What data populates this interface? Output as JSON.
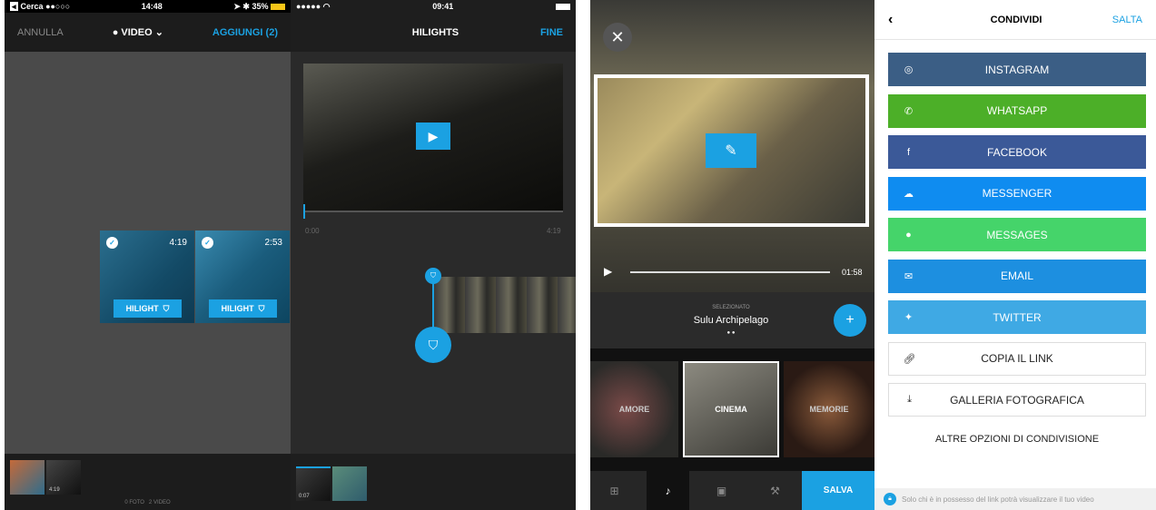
{
  "p1": {
    "status": {
      "left": "Cerca",
      "time": "14:48",
      "right": "35%"
    },
    "nav": {
      "left": "ANNULLA",
      "center": "VIDEO",
      "right": "AGGIUNGI (2)"
    },
    "tiles": [
      {
        "duration": "4:19",
        "label": "HILIGHT"
      },
      {
        "duration": "2:53",
        "label": "HILIGHT"
      }
    ],
    "thumb_duration": "4:19",
    "footer": "0 FOTO   2 VIDEO"
  },
  "p2": {
    "status": {
      "time": "09:41"
    },
    "nav": {
      "title": "HILIGHTS",
      "right": "FINE"
    },
    "time_start": "0:00",
    "time_end": "4:19",
    "thumb_time": "0:07"
  },
  "p3": {
    "duration": "01:58",
    "selected_label": "SELEZIONATO",
    "song": "Sulu Archipelago",
    "themes": [
      "AMORE",
      "CINEMA",
      "MEMORIE"
    ],
    "save": "SALVA"
  },
  "p4": {
    "nav": {
      "title": "CONDIVIDI",
      "right": "SALTA"
    },
    "buttons": [
      {
        "label": "INSTAGRAM",
        "icon": "instagram-icon",
        "color": "#3b5e85"
      },
      {
        "label": "WHATSAPP",
        "icon": "whatsapp-icon",
        "color": "#4caf28"
      },
      {
        "label": "FACEBOOK",
        "icon": "facebook-icon",
        "color": "#3b5998"
      },
      {
        "label": "MESSENGER",
        "icon": "messenger-icon",
        "color": "#0f8cf0"
      },
      {
        "label": "MESSAGES",
        "icon": "messages-icon",
        "color": "#45d46a"
      },
      {
        "label": "EMAIL",
        "icon": "email-icon",
        "color": "#1d8fe0"
      },
      {
        "label": "TWITTER",
        "icon": "twitter-icon",
        "color": "#3fa9e4"
      },
      {
        "label": "COPIA IL LINK",
        "icon": "link-icon"
      },
      {
        "label": "GALLERIA FOTOGRAFICA",
        "icon": "download-icon"
      }
    ],
    "more": "ALTRE OPZIONI DI CONDIVISIONE",
    "footer": "Solo chi è in possesso del link potrà visualizzare il tuo video"
  }
}
